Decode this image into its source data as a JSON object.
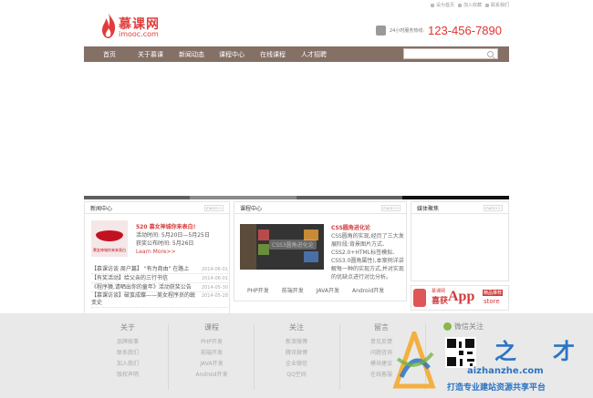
{
  "top_links": [
    "设为首页",
    "加入收藏",
    "联系我们"
  ],
  "logo": {
    "brand": "慕课网",
    "domain": "imooc.com"
  },
  "hotline": {
    "label": "24小时服务热线:",
    "number": "123-456-7890"
  },
  "nav": {
    "items": [
      "首页",
      "关于慕课",
      "新闻动态",
      "课程中心",
      "在线课程",
      "人才招聘"
    ],
    "search_placeholder": ""
  },
  "slider": {
    "colors": [
      "#5f5f5f",
      "#8a8a8a",
      "#5f5f5f",
      "#111111",
      "#5f5f5f"
    ]
  },
  "news": {
    "title": "新闻中心",
    "more": "more>>",
    "pic_caption": "慕女神城你来来表白",
    "headline": "520 慕女神城你来表白!",
    "line1": "活动时间: 5月20日—5月25日",
    "line2": "获奖公布时间: 5月26日",
    "learn_more": "Learn More>>",
    "items": [
      {
        "text": "【慕课访谈 周户篇】 \"有为商由\" 在路上",
        "date": "2014-06-01"
      },
      {
        "text": "【有奖活动】给父亲的三行书信",
        "date": "2014-06-01"
      },
      {
        "text": "《程序猿,请晒出你的童年》活动获奖公告",
        "date": "2014-05-30"
      },
      {
        "text": "【慕课访谈】破茧成蝶——美女程序员的蜕变史",
        "date": "2014-05-28"
      }
    ]
  },
  "course": {
    "title": "课程中心",
    "more": "more>>",
    "pic_caption": "CSS3圆角进化论",
    "item_title": "CSS圆角进化论",
    "desc": "CSS圆角的实现,经历了三大发展阶段:背景图片方式、CSS2.0+HTML标签模拟、CSS3.0圆角属性),本案例详讲解每一种的实现方式,并对实现的优缺点进行对比分析。",
    "tabs": [
      "PHP开发",
      "前端开发",
      "JAVA开发",
      "Android开发"
    ]
  },
  "media": {
    "title": "媒体聚焦",
    "more": "more>>"
  },
  "app_banner": {
    "line1": "慕课网",
    "line2": "喜获",
    "big": "App",
    "tag": "精品推荐",
    "store": "store"
  },
  "footer": {
    "cols": [
      {
        "title": "关于",
        "links": [
          "品牌故事",
          "联系我们",
          "加入我们",
          "版权声明"
        ]
      },
      {
        "title": "课程",
        "links": [
          "PHP开发",
          "前端开发",
          "JAVA开发",
          "Android开发"
        ]
      },
      {
        "title": "关注",
        "links": [
          "新浪微博",
          "腾讯微博",
          "企业微信",
          "QQ空间"
        ]
      },
      {
        "title": "留言",
        "links": [
          "意见反馈",
          "问题咨询",
          "模块建议",
          "在线客服"
        ]
      }
    ],
    "wechat_title": "微信关注"
  },
  "watermark": {
    "zhi": "之",
    "cai": "才",
    "url": "aizhanzhe.com",
    "slogan": "打造专业建站资源共享平台"
  }
}
